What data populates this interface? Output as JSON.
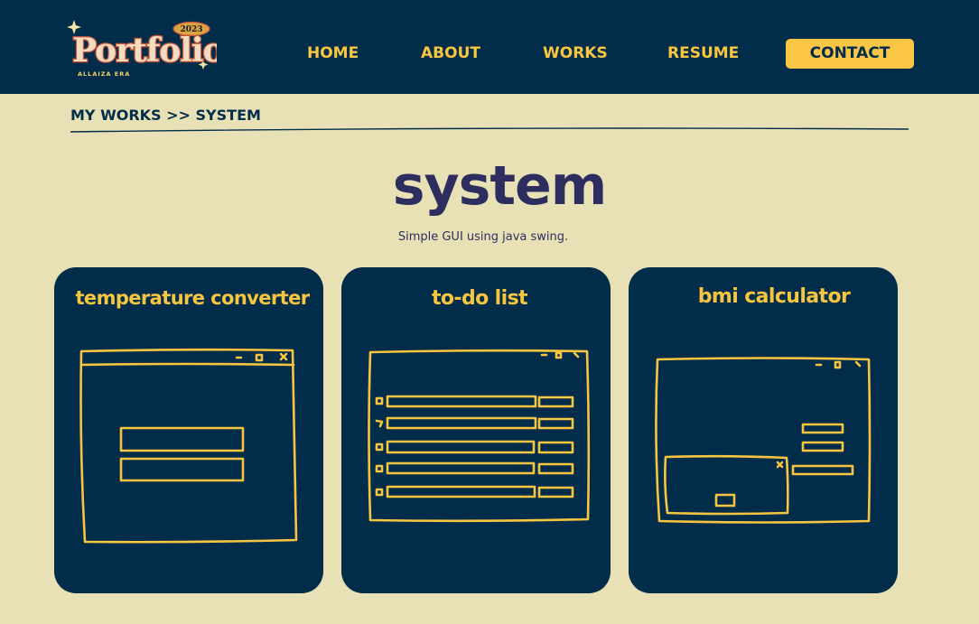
{
  "nav": {
    "logo": {
      "brand_text": "Portfolio",
      "year_text": "2023",
      "sub_text": "ALLAIZA ERA"
    },
    "items": [
      {
        "label": "HOME"
      },
      {
        "label": "ABOUT"
      },
      {
        "label": "WORKS"
      },
      {
        "label": "RESUME"
      }
    ],
    "contact_label": "CONTACT"
  },
  "breadcrumb": "MY WORKS >> SYSTEM",
  "page": {
    "title": "system",
    "subtitle": "Simple GUI using java swing."
  },
  "cards": [
    {
      "title": "temperature converter",
      "sketch": "window-with-two-input-fields"
    },
    {
      "title": "to-do list",
      "sketch": "window-with-checkbox-list"
    },
    {
      "title": "bmi calculator",
      "sketch": "window-with-fields-and-dialog"
    }
  ],
  "colors": {
    "navbar_bg": "#022d4a",
    "page_bg": "#e8e1b6",
    "accent_yellow": "#f7c53f",
    "contact_button": "#fbc646",
    "title_navy": "#2d2e5f",
    "card_bg": "#022d4a"
  }
}
